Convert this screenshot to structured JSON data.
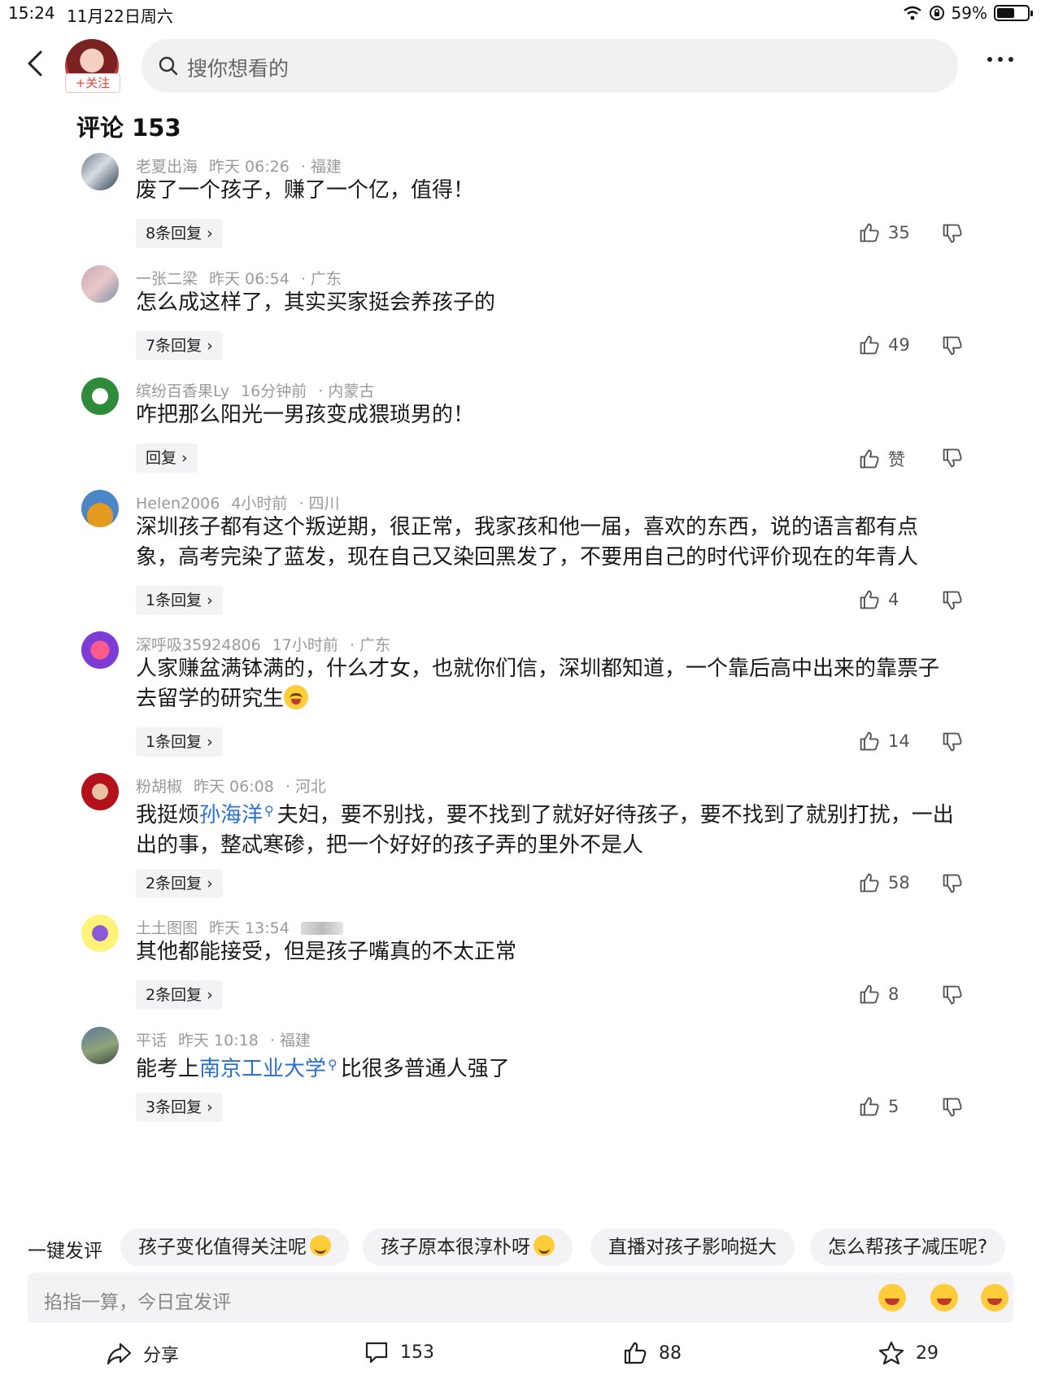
{
  "status": {
    "time": "15:24",
    "date": "11月22日周六",
    "battery": "59%",
    "battery_level": 0.59
  },
  "header": {
    "follow_label": "+关注",
    "search_placeholder": "搜你想看的"
  },
  "heading": "评论 153",
  "comments": [
    {
      "user": "老夏出海",
      "time": "昨天 06:26",
      "region": "福建",
      "text": "废了一个孩子，赚了一个亿，值得！",
      "replies": "8条回复",
      "likes": "35"
    },
    {
      "user": "一张二梁",
      "time": "昨天 06:54",
      "region": "广东",
      "text": "怎么成这样了，其实买家挺会养孩子的",
      "replies": "7条回复",
      "likes": "49"
    },
    {
      "user": "缤纷百香果Ly",
      "time": "16分钟前",
      "region": "内蒙古",
      "text": "咋把那么阳光一男孩变成猥琐男的！",
      "replies": "回复",
      "likes": "赞"
    },
    {
      "user": "Helen2006",
      "time": "4小时前",
      "region": "四川",
      "text": "深圳孩子都有这个叛逆期，很正常，我家孩和他一届，喜欢的东西，说的语言都有点象，高考完染了蓝发，现在自己又染回黑发了，不要用自己的时代评价现在的年青人",
      "replies": "1条回复",
      "likes": "4"
    },
    {
      "user": "深呼吸35924806",
      "time": "17小时前",
      "region": "广东",
      "text": "人家赚盆满钵满的，什么才女，也就你们信，深圳都知道，一个靠后高中出来的靠票子去留学的研究生",
      "replies": "1条回复",
      "likes": "14"
    },
    {
      "user": "粉胡椒",
      "time": "昨天 06:08",
      "region": "河北",
      "text_before": "我挺烦",
      "text_link": "孙海洋",
      "text_after": "夫妇，要不别找，要不找到了就好好待孩子，要不找到了就别打扰，一出出的事，整忒寒碜，把一个好好的孩子弄的里外不是人",
      "replies": "2条回复",
      "likes": "58"
    },
    {
      "user": "土土图图",
      "time": "昨天 13:54",
      "region": "",
      "text": "其他都能接受，但是孩子嘴真的不太正常",
      "replies": "2条回复",
      "likes": "8"
    },
    {
      "user": "平话",
      "time": "昨天 10:18",
      "region": "福建",
      "text_before": "能考上",
      "text_link": "南京工业大学",
      "text_after": "比很多普通人强了",
      "replies": "3条回复",
      "likes": "5"
    }
  ],
  "quick_reply": {
    "label": "一键发评",
    "chips": [
      "孩子变化值得关注呢",
      "孩子原本很淳朴呀",
      "直播对孩子影响挺大",
      "怎么帮孩子减压呢?"
    ]
  },
  "input": {
    "placeholder": "掐指一算，今日宜发评"
  },
  "actions": {
    "share": "分享",
    "comments": "153",
    "likes": "88",
    "favorites": "29"
  },
  "colors": {
    "link": "#2a6fd6",
    "follow": "#e8413b",
    "chip_bg": "#f3f3f5"
  }
}
